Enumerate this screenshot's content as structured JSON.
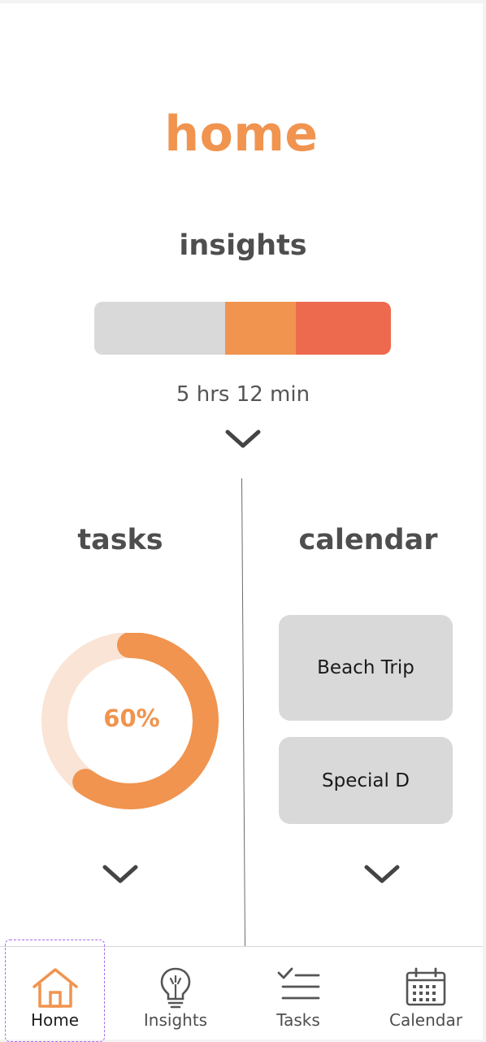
{
  "header": {
    "title": "home"
  },
  "insights": {
    "title": "insights",
    "total_time": "5 hrs 12 min",
    "bar_segments": [
      {
        "color": "#d9d9d9",
        "fraction": 0.44
      },
      {
        "color": "#f0944f",
        "fraction": 0.24
      },
      {
        "color": "#ed6a4e",
        "fraction": 0.32
      }
    ]
  },
  "tasks": {
    "title": "tasks",
    "progress_label": "60%",
    "progress": 0.6,
    "ring_color": "#f0944f",
    "track_color": "#f9e4d6"
  },
  "calendar": {
    "title": "calendar",
    "events": [
      {
        "label": "Beach Trip"
      },
      {
        "label": "Special D"
      }
    ]
  },
  "nav": {
    "items": [
      {
        "label": "Home",
        "icon": "home-icon",
        "active": true
      },
      {
        "label": "Insights",
        "icon": "lightbulb-icon",
        "active": false
      },
      {
        "label": "Tasks",
        "icon": "checklist-icon",
        "active": false
      },
      {
        "label": "Calendar",
        "icon": "calendar-icon",
        "active": false
      }
    ],
    "active_color": "#f0944f"
  }
}
